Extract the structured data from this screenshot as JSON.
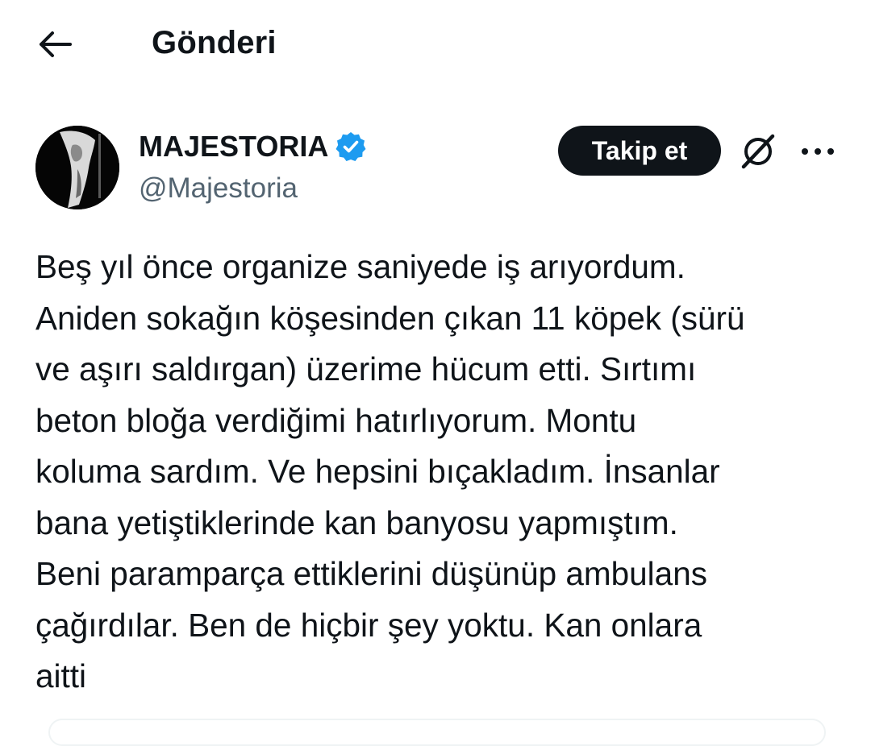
{
  "header": {
    "title": "Gönderi",
    "back_icon": "arrow-left-icon"
  },
  "post": {
    "author": {
      "display_name": "MAJESTORIA",
      "handle": "@Majestoria",
      "verified": true,
      "verified_color": "#1d9bf0"
    },
    "actions": {
      "follow_label": "Takip et",
      "grok_icon": "grok-icon",
      "more_icon": "more-horizontal-icon"
    },
    "text": "Beş yıl önce organize saniyede iş arıyordum.\nAniden sokağın köşesinden çıkan 11 köpek (sürü\nve aşırı saldırgan) üzerime hücum etti. Sırtımı\nbeton bloğa verdiğimi hatırlıyorum. Montu\nkoluma sardım. Ve hepsini bıçakladım. İnsanlar\nbana yetiştiklerinde kan banyosu yapmıştım.\nBeni paramparça ettiklerini düşünüp ambulans\nçağırdılar. Ben de hiçbir şey yoktu. Kan onlara\naitti"
  },
  "colors": {
    "text": "#0f1419",
    "secondary_text": "#536471",
    "button_bg": "#0f1419",
    "button_text": "#ffffff"
  }
}
